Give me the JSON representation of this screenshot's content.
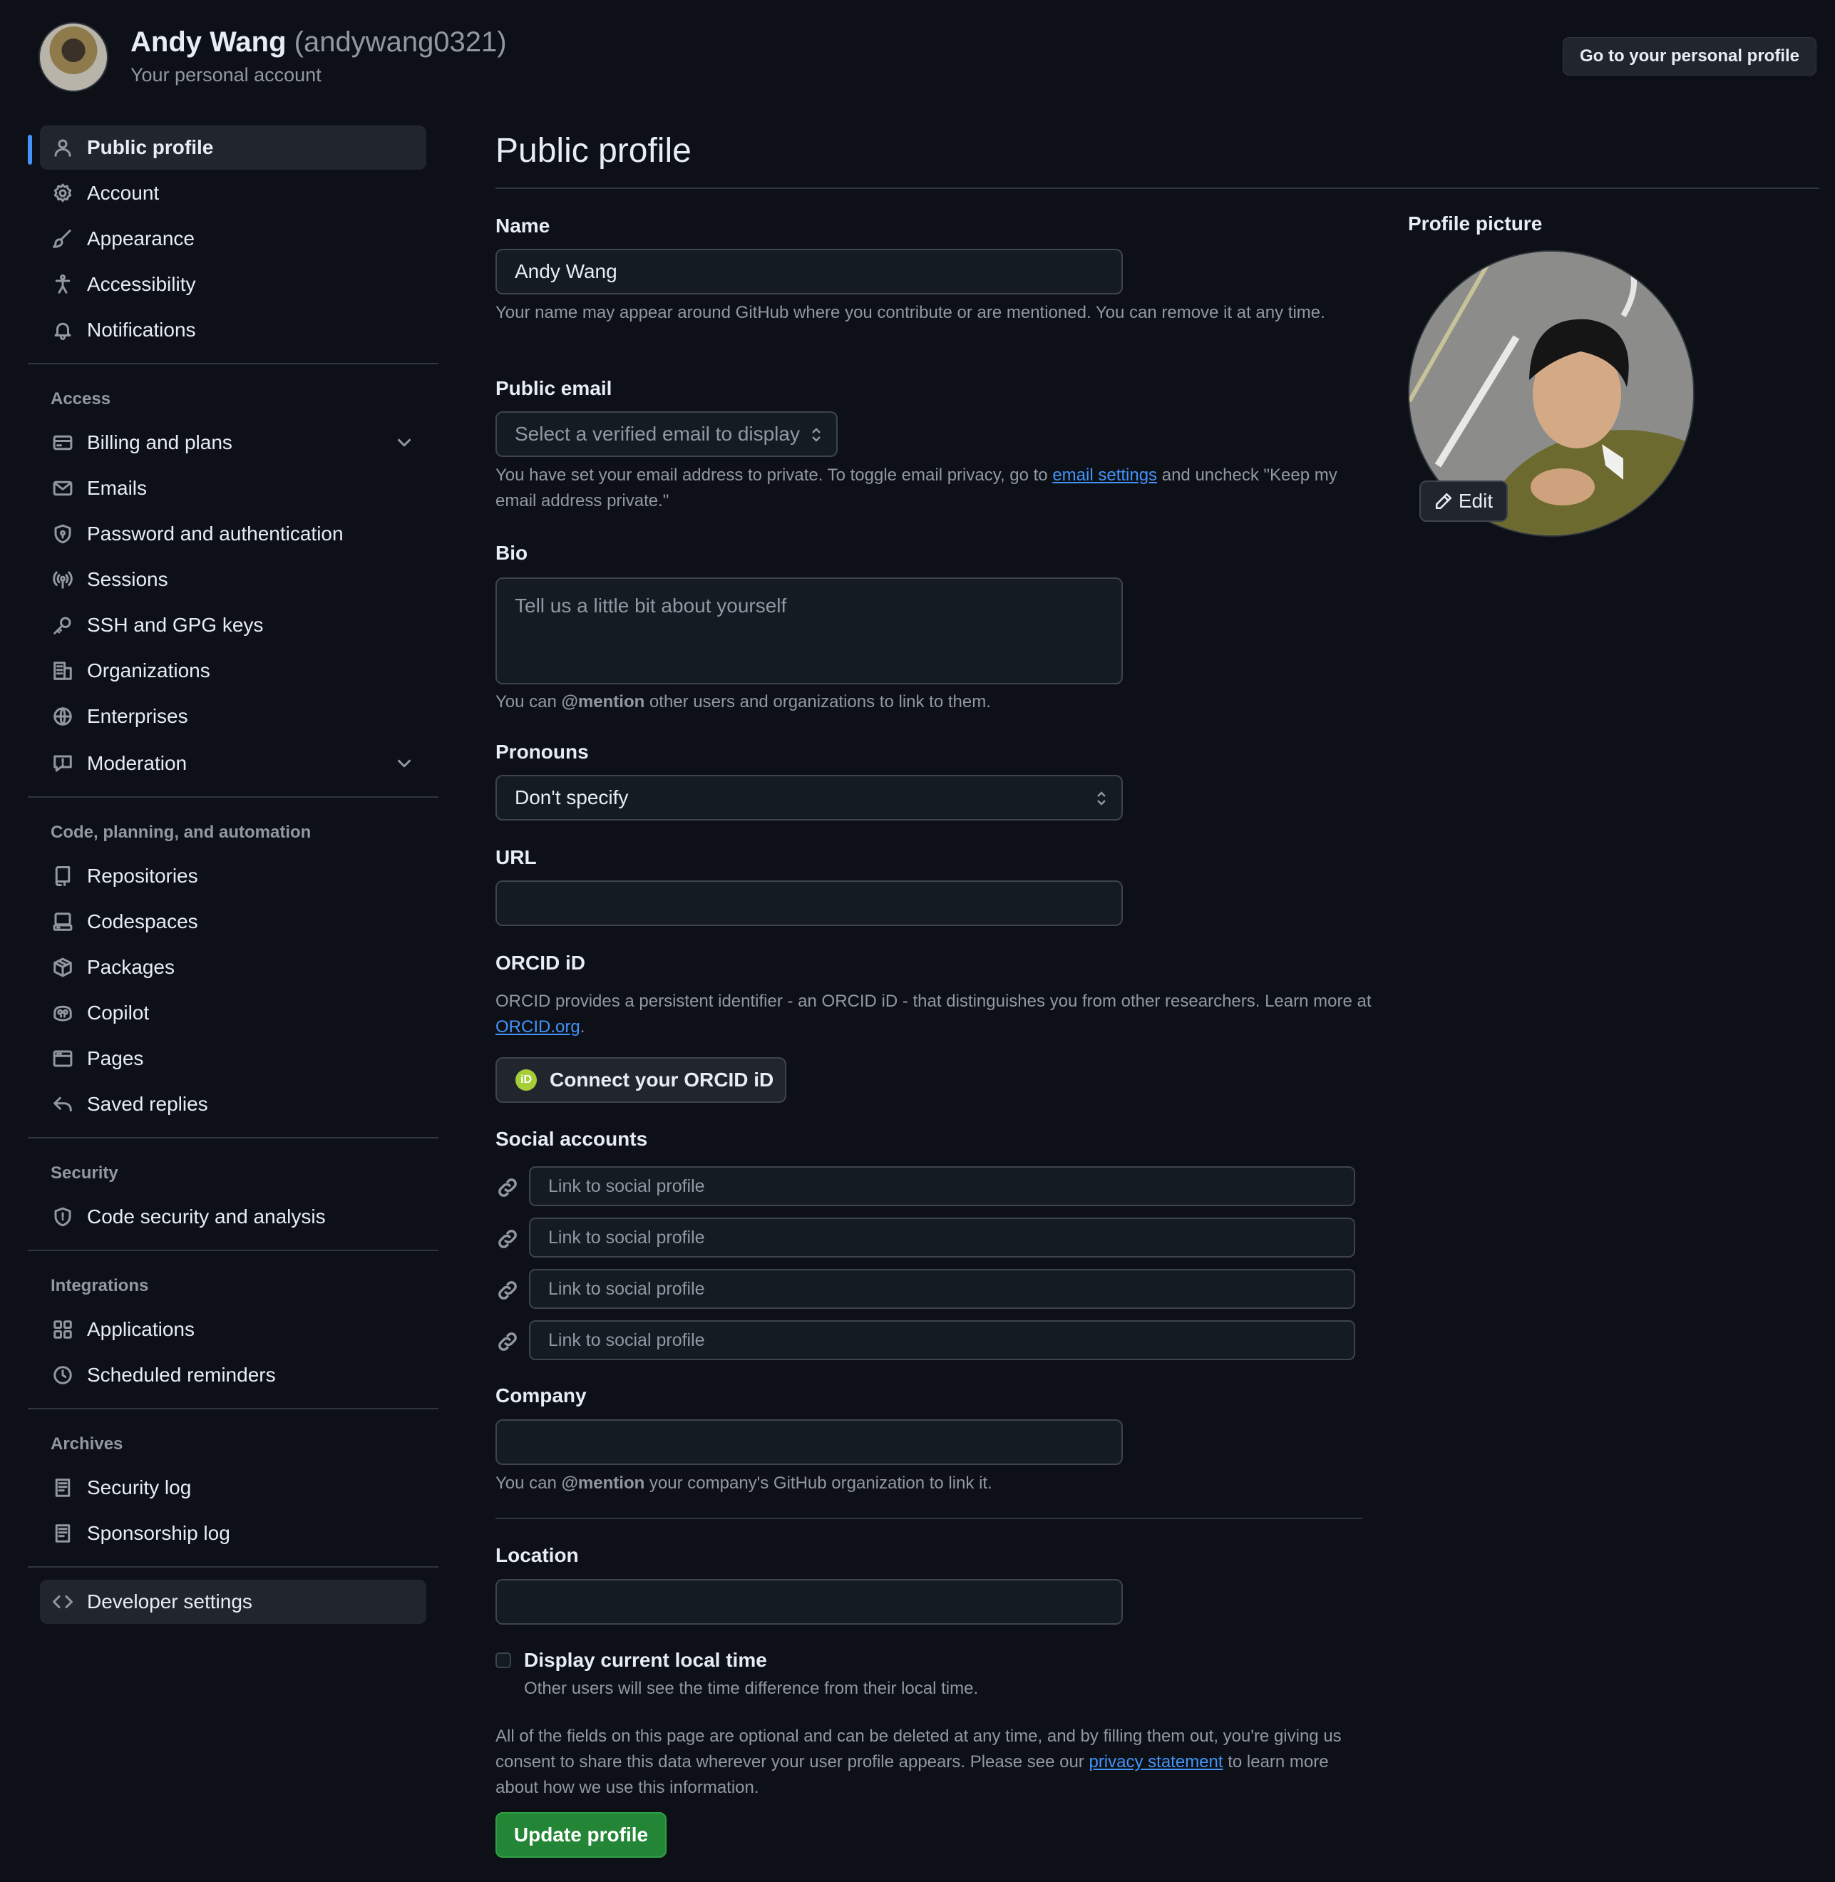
{
  "header": {
    "name": "Andy Wang",
    "login": "(andywang0321)",
    "subtitle": "Your personal account",
    "personal_profile_button": "Go to your personal profile"
  },
  "sidebar": {
    "items_top": [
      {
        "label": "Public profile",
        "icon": "person-icon",
        "active": true
      },
      {
        "label": "Account",
        "icon": "gear-icon"
      },
      {
        "label": "Appearance",
        "icon": "paintbrush-icon"
      },
      {
        "label": "Accessibility",
        "icon": "accessibility-icon"
      },
      {
        "label": "Notifications",
        "icon": "bell-icon"
      }
    ],
    "access_heading": "Access",
    "access_items": [
      {
        "label": "Billing and plans",
        "icon": "credit-card-icon",
        "expandable": true
      },
      {
        "label": "Emails",
        "icon": "mail-icon"
      },
      {
        "label": "Password and authentication",
        "icon": "shield-lock-icon"
      },
      {
        "label": "Sessions",
        "icon": "broadcast-icon"
      },
      {
        "label": "SSH and GPG keys",
        "icon": "key-icon"
      },
      {
        "label": "Organizations",
        "icon": "organization-icon"
      },
      {
        "label": "Enterprises",
        "icon": "globe-icon"
      },
      {
        "label": "Moderation",
        "icon": "report-icon",
        "expandable": true
      }
    ],
    "code_heading": "Code, planning, and automation",
    "code_items": [
      {
        "label": "Repositories",
        "icon": "repo-icon"
      },
      {
        "label": "Codespaces",
        "icon": "codespaces-icon"
      },
      {
        "label": "Packages",
        "icon": "package-icon"
      },
      {
        "label": "Copilot",
        "icon": "copilot-icon"
      },
      {
        "label": "Pages",
        "icon": "browser-icon"
      },
      {
        "label": "Saved replies",
        "icon": "reply-icon"
      }
    ],
    "security_heading": "Security",
    "security_items": [
      {
        "label": "Code security and analysis",
        "icon": "codescan-icon"
      }
    ],
    "integrations_heading": "Integrations",
    "integrations_items": [
      {
        "label": "Applications",
        "icon": "apps-icon"
      },
      {
        "label": "Scheduled reminders",
        "icon": "clock-icon"
      }
    ],
    "archives_heading": "Archives",
    "archives_items": [
      {
        "label": "Security log",
        "icon": "log-icon"
      },
      {
        "label": "Sponsorship log",
        "icon": "log-icon"
      }
    ],
    "developer_settings": {
      "label": "Developer settings",
      "icon": "code-icon"
    }
  },
  "main": {
    "title": "Public profile",
    "name_label": "Name",
    "name_value": "Andy Wang",
    "name_help": "Your name may appear around GitHub where you contribute or are mentioned. You can remove it at any time.",
    "email_label": "Public email",
    "email_select": "Select a verified email to display",
    "email_help_pre": "You have set your email address to private. To toggle email privacy, go to ",
    "email_help_link": "email settings",
    "email_help_post": " and uncheck \"Keep my email address private.\"",
    "bio_label": "Bio",
    "bio_placeholder": "Tell us a little bit about yourself",
    "bio_help_pre": "You can ",
    "bio_help_mention": "@mention",
    "bio_help_post": " other users and organizations to link to them.",
    "pronouns_label": "Pronouns",
    "pronouns_value": "Don't specify",
    "url_label": "URL",
    "url_value": "",
    "orcid_label": "ORCID iD",
    "orcid_help_pre": "ORCID provides a persistent identifier - an ORCID iD - that distinguishes you from other researchers. Learn more at ",
    "orcid_help_link": "ORCID.org",
    "orcid_help_post": ".",
    "orcid_badge": "iD",
    "orcid_button": "Connect your ORCID iD",
    "social_label": "Social accounts",
    "social_placeholders": [
      "Link to social profile",
      "Link to social profile",
      "Link to social profile",
      "Link to social profile"
    ],
    "company_label": "Company",
    "company_value": "",
    "company_help_pre": "You can ",
    "company_help_mention": "@mention",
    "company_help_post": " your company's GitHub organization to link it.",
    "location_label": "Location",
    "location_value": "",
    "local_time_label": "Display current local time",
    "local_time_checked": false,
    "local_time_help": "Other users will see the time difference from their local time.",
    "consent_pre": "All of the fields on this page are optional and can be deleted at any time, and by filling them out, you're giving us consent to share this data wherever your user profile appears. Please see our ",
    "consent_link": "privacy statement",
    "consent_post": " to learn more about how we use this information.",
    "update_button": "Update profile"
  },
  "profile_picture": {
    "label": "Profile picture",
    "edit_button": "Edit"
  },
  "colors": {
    "background": "#0d1117",
    "accent": "#4493f8",
    "success": "#238636",
    "muted": "#9198a1"
  }
}
